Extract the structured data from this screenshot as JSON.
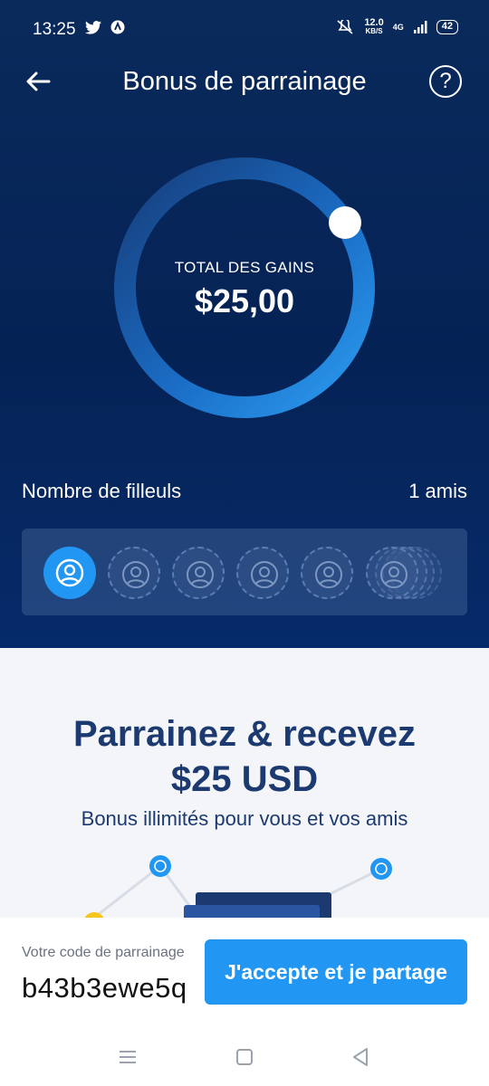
{
  "status_bar": {
    "time": "13:25",
    "net_speed_value": "12.0",
    "net_speed_unit": "KB/S",
    "network": "4G",
    "battery": "42"
  },
  "header": {
    "title": "Bonus de parrainage",
    "help_label": "?"
  },
  "earnings": {
    "label": "TOTAL DES GAINS",
    "value": "$25,00"
  },
  "referrals": {
    "label": "Nombre de filleuls",
    "count": "1 amis"
  },
  "promo": {
    "title_line1": "Parrainez & recevez",
    "title_line2": "$25 USD",
    "subtitle": "Bonus illimités pour vous et vos amis"
  },
  "referral_code": {
    "label": "Votre code de parrainage",
    "value": "b43b3ewe5q"
  },
  "actions": {
    "share_label": "J'accepte et je partage"
  },
  "colors": {
    "accent": "#2196f3",
    "navy": "#1c3a70",
    "hero_bg": "#052255"
  }
}
